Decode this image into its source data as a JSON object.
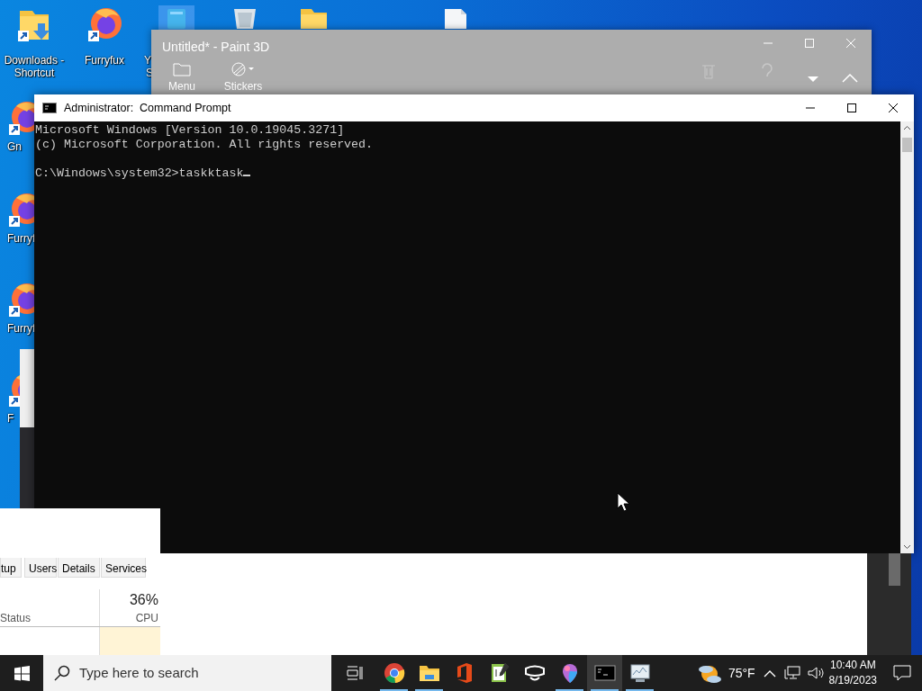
{
  "desktop_icons": [
    {
      "kind": "folder-shortcut",
      "label_lines": [
        "Downloads -",
        "Shortcut"
      ],
      "selected": false
    },
    {
      "kind": "browser",
      "label_lines": [
        "Furryfux"
      ],
      "selected": false
    },
    {
      "kind": "device",
      "label_lines": [
        "Y",
        "S"
      ],
      "selected": true
    },
    {
      "kind": "recycle",
      "selected": false
    },
    {
      "kind": "folder",
      "selected": false
    },
    {
      "kind": "file",
      "selected": false
    },
    {
      "kind": "browser",
      "label_lines": [
        "Gn"
      ],
      "selected": false
    },
    {
      "kind": "browser",
      "label_lines": [
        "Furryf"
      ],
      "selected": false
    },
    {
      "kind": "browser",
      "label_lines": [
        "Furryf"
      ],
      "selected": false
    },
    {
      "kind": "browser",
      "label_lines": [
        "F"
      ],
      "selected": false
    }
  ],
  "paint3d": {
    "title": "Untitled* - Paint 3D",
    "tools": [
      {
        "kind": "folder",
        "label": "Menu"
      },
      {
        "kind": "sticker",
        "label": "Stickers"
      }
    ]
  },
  "command_prompt": {
    "title": "Administrator:  Command Prompt",
    "output": [
      "Microsoft Windows [Version 10.0.19045.3271]",
      "(c) Microsoft Corporation. All rights reserved."
    ],
    "prompt": "C:\\Windows\\system32>taskktask"
  },
  "task_manager": {
    "tabs": [
      {
        "label": "tup",
        "selected": false
      },
      {
        "label": "Users",
        "selected": false
      },
      {
        "label": "Details",
        "selected": false
      },
      {
        "label": "Services",
        "selected": false
      }
    ],
    "status_header": "Status",
    "cpu_percent": "36%",
    "cpu_header": "CPU"
  },
  "taskbar": {
    "search_placeholder": "Type here to search",
    "apps": [
      {
        "kind": "chrome",
        "running": true,
        "active": false
      },
      {
        "kind": "explorer",
        "running": true,
        "active": false
      },
      {
        "kind": "office",
        "running": false,
        "active": false
      },
      {
        "kind": "notepad",
        "running": false,
        "active": false
      },
      {
        "kind": "mixed-reality",
        "running": false,
        "active": false
      },
      {
        "kind": "paint3d",
        "running": true,
        "active": false
      },
      {
        "kind": "cmd",
        "running": true,
        "active": true
      },
      {
        "kind": "taskmgr",
        "running": true,
        "active": false
      }
    ],
    "weather": "75°F",
    "time": "10:40 AM",
    "date": "8/19/2023"
  }
}
